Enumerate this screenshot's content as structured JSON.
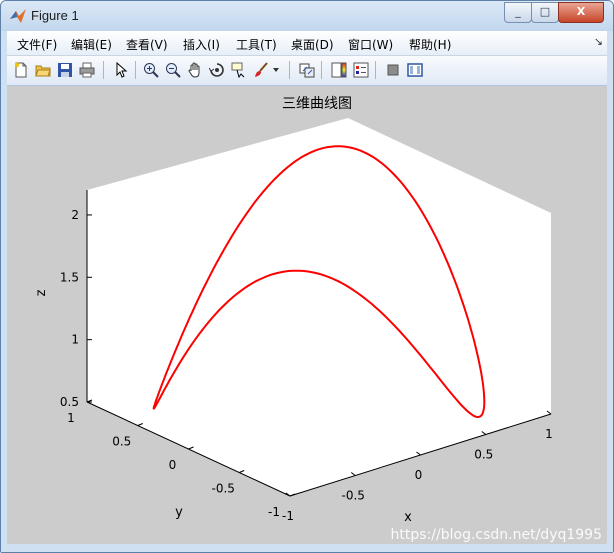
{
  "window": {
    "title": "Figure 1",
    "controls": {
      "minimize": "_",
      "maximize": "□",
      "close": "X"
    }
  },
  "menu": [
    {
      "name": "file",
      "label": "文件(F)"
    },
    {
      "name": "edit",
      "label": "编辑(E)"
    },
    {
      "name": "view",
      "label": "查看(V)"
    },
    {
      "name": "insert",
      "label": "插入(I)"
    },
    {
      "name": "tools",
      "label": "工具(T)"
    },
    {
      "name": "desktop",
      "label": "桌面(D)"
    },
    {
      "name": "window",
      "label": "窗口(W)"
    },
    {
      "name": "help",
      "label": "帮助(H)"
    }
  ],
  "menu_corner_icon": "dock-arrow-icon",
  "toolbar": [
    "new-figure-icon",
    "open-file-icon",
    "save-icon",
    "print-icon",
    "select-arrow-icon",
    "zoom-in-icon",
    "zoom-out-icon",
    "pan-hand-icon",
    "rotate-3d-icon",
    "data-cursor-icon",
    "brush-icon",
    "brush-dropdown-icon",
    "link-plot-icon",
    "colorbar-icon",
    "legend-icon",
    "hide-plot-tools-icon",
    "show-plot-tools-icon"
  ],
  "watermark": "https://blog.csdn.net/dyq1995",
  "chart_data": {
    "type": "line3d",
    "title": "三维曲线图",
    "xlabel": "x",
    "ylabel": "y",
    "zlabel": "z",
    "xlim": [
      -1,
      1
    ],
    "ylim": [
      -1,
      1
    ],
    "zlim": [
      0.5,
      2.2
    ],
    "xticks": [
      "-1",
      "-0.5",
      "0",
      "0.5",
      "1"
    ],
    "yticks": [
      "1",
      "0.5",
      "0",
      "-0.5",
      "-1"
    ],
    "zticks": [
      "0.5",
      "1",
      "1.5",
      "2"
    ],
    "grid": false,
    "view": {
      "azimuth": -37.5,
      "elevation": 30
    },
    "series": [
      {
        "color": "#ff0000",
        "equation": {
          "x": "sin(t)",
          "y": "cos(t)",
          "z": "1.3 + 0.8*sin(2t)"
        },
        "t_range": [
          0,
          6.2832
        ],
        "points": [
          [
            0.0,
            1.0,
            1.3
          ],
          [
            0.5,
            0.866,
            1.993
          ],
          [
            0.866,
            0.5,
            1.993
          ],
          [
            1.0,
            0.0,
            1.3
          ],
          [
            0.866,
            -0.5,
            0.607
          ],
          [
            0.5,
            -0.866,
            0.607
          ],
          [
            0.0,
            -1.0,
            1.3
          ],
          [
            -0.5,
            -0.866,
            1.993
          ],
          [
            -0.866,
            -0.5,
            1.993
          ],
          [
            -1.0,
            0.0,
            1.3
          ],
          [
            -0.866,
            0.5,
            0.607
          ],
          [
            -0.5,
            0.866,
            0.607
          ],
          [
            0.0,
            1.0,
            1.3
          ]
        ]
      }
    ]
  }
}
